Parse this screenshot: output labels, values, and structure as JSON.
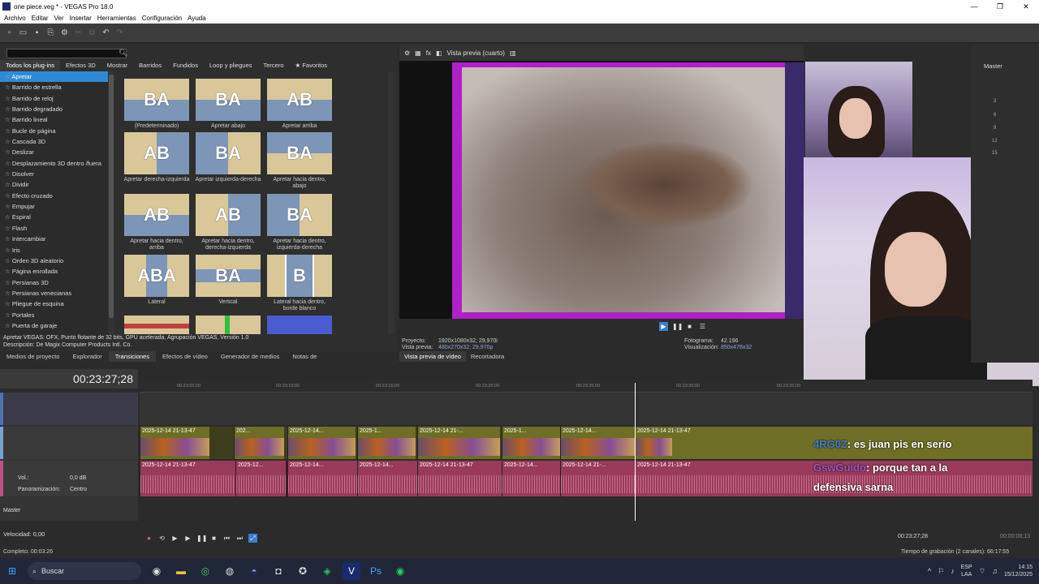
{
  "window": {
    "title": "one piece.veg * - VEGAS Pro 18.0",
    "controls": [
      "—",
      "❐",
      "✕"
    ]
  },
  "menu": [
    "Archivo",
    "Editar",
    "Ver",
    "Insertar",
    "Herramientas",
    "Configuración",
    "Ayuda"
  ],
  "plugin_tabs": [
    "Todos los plug-ins",
    "Efectos 3D",
    "Mostrar",
    "Barridos",
    "Fundidos",
    "Loop y pliegues",
    "Tercero",
    "★ Favoritos"
  ],
  "transitions": [
    "Apretar",
    "Barrido de estrella",
    "Barrido de reloj",
    "Barrido degradado",
    "Barrido lineal",
    "Bucle de página",
    "Cascada 3D",
    "Deslizar",
    "Desplazamiento 3D dentro /fuera",
    "Disolver",
    "Dividir",
    "Efecto cruzado",
    "Empujar",
    "Espiral",
    "Flash",
    "Intercambiar",
    "Iris",
    "Orden 3D aleatorio",
    "Página enrollada",
    "Persianas 3D",
    "Persianas venecianas",
    "Pliegue de esquina",
    "Portales",
    "Puerta de garaje"
  ],
  "presets": [
    {
      "caption": "(Predeterminado)",
      "letters": "BA"
    },
    {
      "caption": "Apretar abajo",
      "letters": "BA"
    },
    {
      "caption": "Apretar arriba",
      "letters": "AB"
    },
    {
      "caption": "Apretar derecha-izquierda",
      "letters": "AB"
    },
    {
      "caption": "Apretar izquierda-derecha",
      "letters": "BA"
    },
    {
      "caption": "Apretar hacia dentro, abajo",
      "letters": "BA"
    },
    {
      "caption": "Apretar hacia dentro, arriba",
      "letters": "AB"
    },
    {
      "caption": "Apretar hacia dentro, derecha-izquierda",
      "letters": "AB"
    },
    {
      "caption": "Apretar hacia dentro, izquierda-derecha",
      "letters": "BA"
    },
    {
      "caption": "Lateral",
      "letters": "ABA"
    },
    {
      "caption": "Vertical",
      "letters": "BA"
    },
    {
      "caption": "Lateral hacia dentro, borde blanco",
      "letters": "B"
    }
  ],
  "description": {
    "line1": "Apretar VEGAS: OFX, Punto flotante de 32 bits, GPU acelerada, Agrupación VEGAS, Versión 1.0",
    "line2": "Descripción: De Magix Computer Products Intl. Co."
  },
  "left_tabs": [
    "Medios de proyecto",
    "Explorador",
    "Transiciones",
    "Efectos de vídeo",
    "Generador de medios",
    "Notas de"
  ],
  "preview": {
    "mode": "Vista previa (cuarto)",
    "project_label": "Proyecto:",
    "project_value": "1920x1080x32; 29,970i",
    "preview_label": "Vista previa:",
    "preview_value": "480x270x32; 29,970p",
    "frame_label": "Fotograma:",
    "frame_value": "42.196",
    "display_label": "Visualización:",
    "display_value": "850x478x32",
    "tabs": [
      "Vista previa de vídeo",
      "Recortadora"
    ]
  },
  "master": {
    "label": "Master",
    "scale": [
      "3",
      "6",
      "9",
      "12",
      "15"
    ]
  },
  "timeline": {
    "timecode": "00:23:27;28",
    "ruler": [
      "00:23:05;00",
      "00:23:10;00",
      "00:23:15;00",
      "00:23:20;00",
      "00:23:25;00",
      "00:23:30;00",
      "00:23:35;00"
    ],
    "video_clips": [
      "2025-12-14 21-13-47",
      "202...",
      "2025-12-14...",
      "2025-1...",
      "2025-12-14 21-...",
      "2025-1...",
      "2025-12-14...",
      "2025-12-14 21-13-47"
    ],
    "audio_clips": [
      "2025-12-14 21-13-47",
      "2025-12...",
      "2025-12-14...",
      "2025-12-14...",
      "2025-12-14 21-13-47",
      "2025-12-14...",
      "2025-12-14 21-...",
      "2025-12-14 21-13-47"
    ],
    "vol_label": "Vol.:",
    "vol_value": "0,0 dB",
    "pan_label": "Panoramización:",
    "pan_value": "Centro",
    "master_label": "Master",
    "speed_label": "Velocidad: 0,00",
    "cursor_time": "00:23:27;28",
    "end_time": "00:00:08;13"
  },
  "chat": {
    "user1": "4RG0Z",
    "msg1": ": es juan pis en serio",
    "user2": "GswGuido",
    "msg2": ": porque tan a la",
    "msg2b": "defensiva sarna"
  },
  "status": {
    "left": "Completo: 00:03:26",
    "right": "Tiempo de grabación (2 canales): 66:17:55"
  },
  "taskbar": {
    "search": "Buscar",
    "lang1": "ESP",
    "lang2": "LAA",
    "time": "14:15",
    "date": "15/12/2025"
  }
}
